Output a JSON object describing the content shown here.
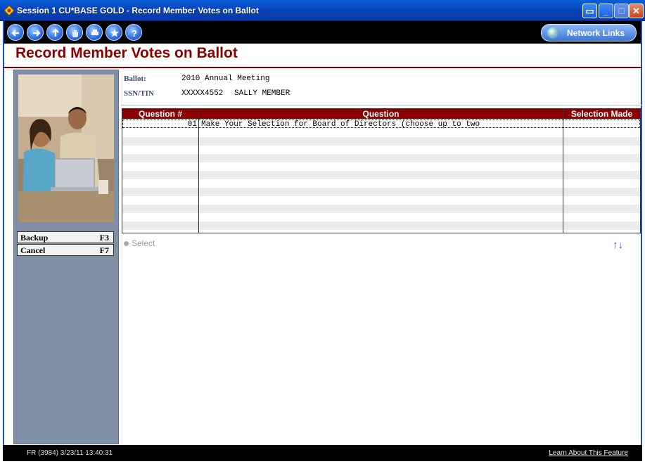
{
  "window": {
    "title": "Session 1 CU*BASE GOLD - Record Member Votes on Ballot"
  },
  "toolbar": {
    "nav_icons": [
      "back-arrow-icon",
      "forward-arrow-icon",
      "up-arrow-icon",
      "hand-icon",
      "print-icon",
      "star-icon",
      "help-icon"
    ],
    "network_links_label": "Network Links"
  },
  "page": {
    "heading": "Record Member Votes on Ballot"
  },
  "info": {
    "ballot_label": "Ballot:",
    "ballot_value": "2010 Annual Meeting",
    "ssn_label": "SSN/TIN",
    "ssn_value": "XXXXX4552",
    "member_name": "SALLY MEMBER"
  },
  "grid": {
    "columns": [
      "Question #",
      "Question",
      "Selection Made"
    ],
    "rows": [
      {
        "number": "01",
        "question": "Make Your Selection for Board of Directors (choose up to two",
        "selection": ""
      }
    ]
  },
  "options": {
    "select_label": "Select"
  },
  "actions": [
    {
      "label": "Backup",
      "key": "F3"
    },
    {
      "label": "Cancel",
      "key": "F7"
    }
  ],
  "status": {
    "left": "FR (3984) 3/23/11 13:40:31",
    "right": "Learn About This Feature"
  },
  "colors": {
    "accent": "#8b0000",
    "titlebar": "#0842b8",
    "panel": "#7f8fa5"
  }
}
